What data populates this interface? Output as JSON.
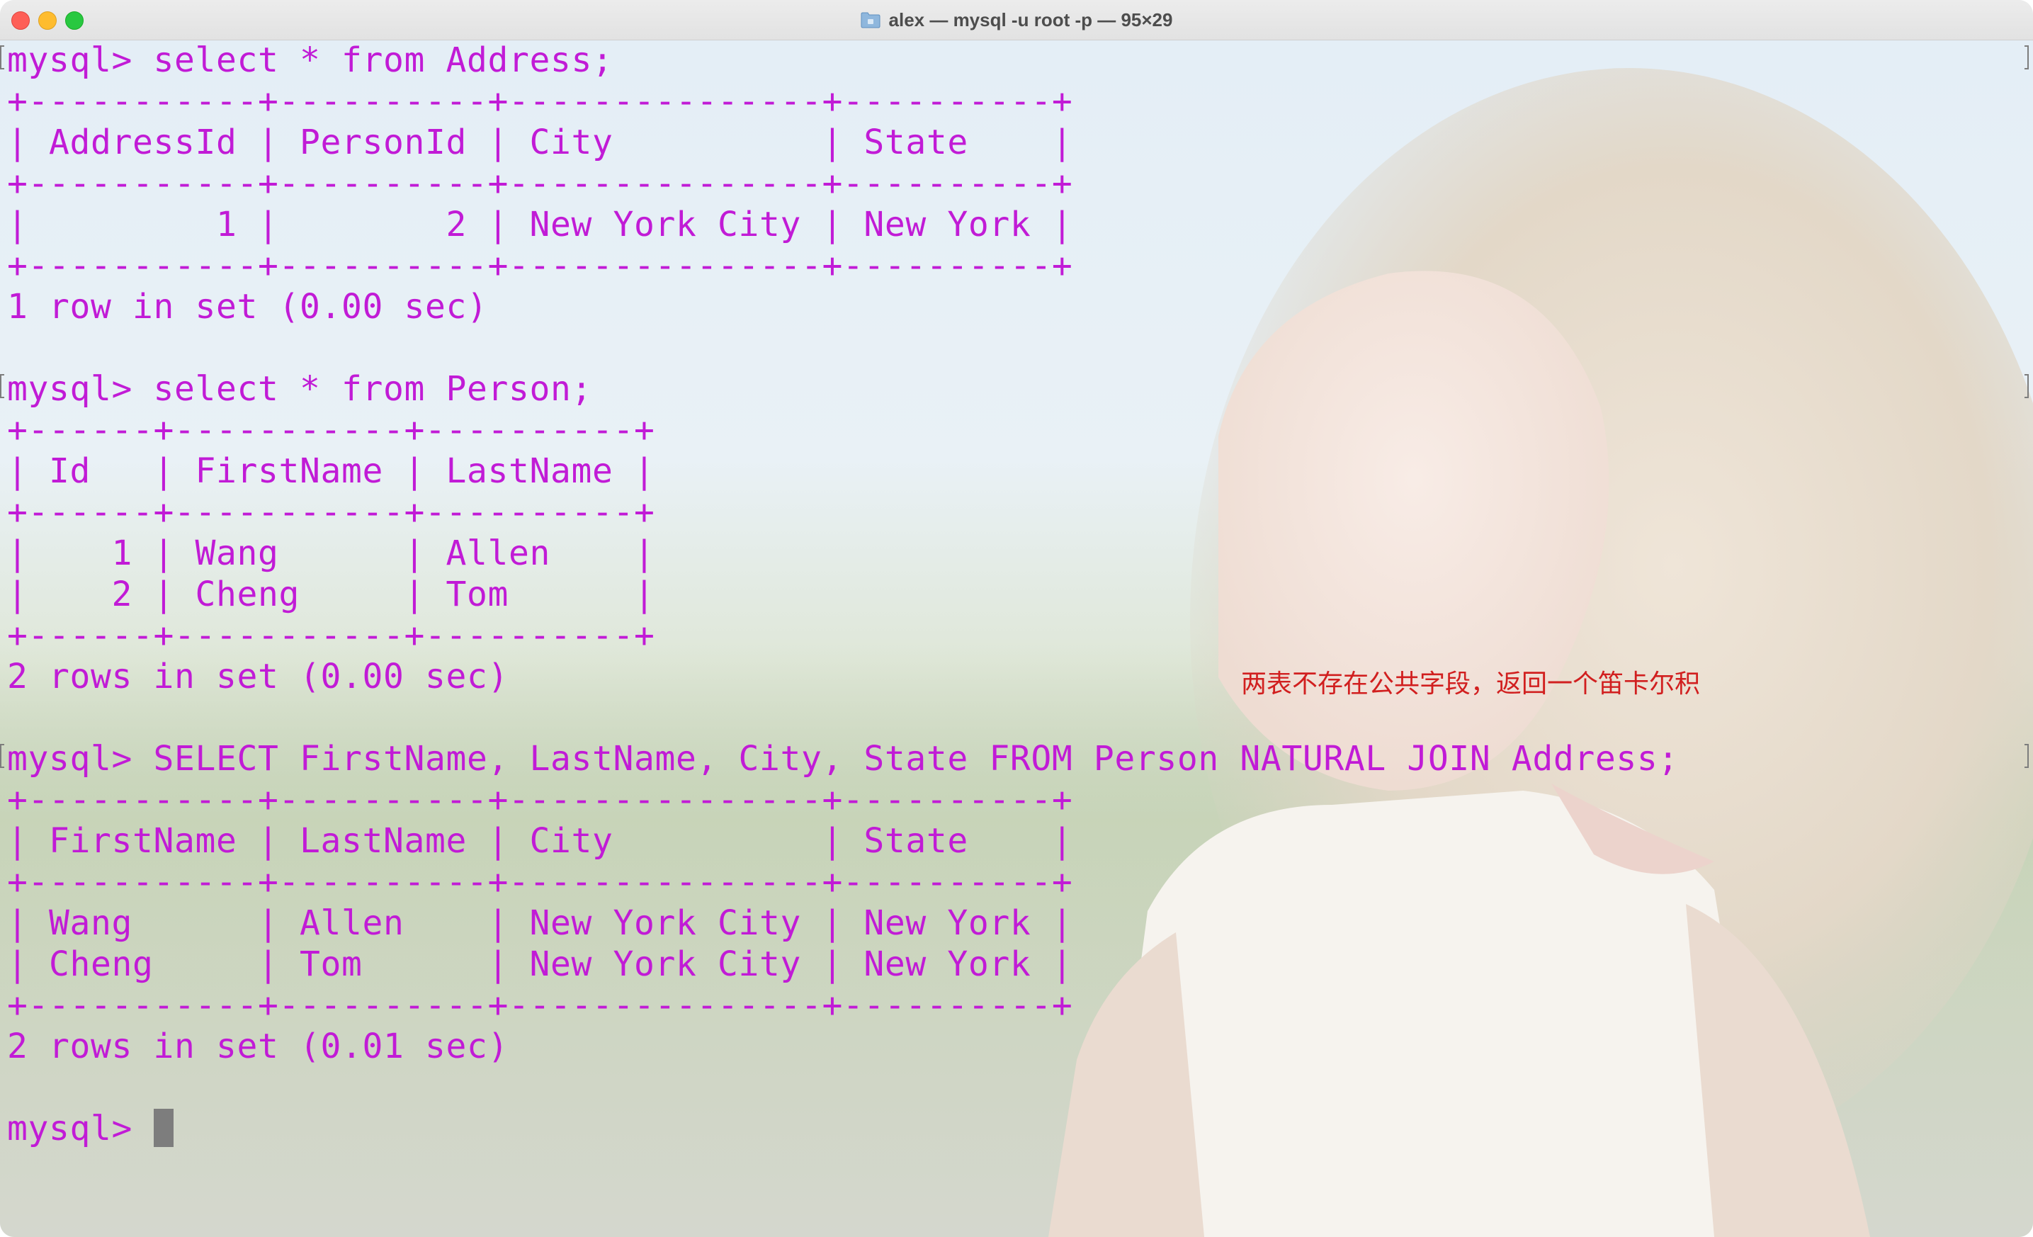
{
  "window": {
    "title": "alex — mysql -u root -p — 95×29"
  },
  "terminal": {
    "lines": [
      "mysql> select * from Address;",
      "+-----------+----------+---------------+----------+",
      "| AddressId | PersonId | City          | State    |",
      "+-----------+----------+---------------+----------+",
      "|         1 |        2 | New York City | New York |",
      "+-----------+----------+---------------+----------+",
      "1 row in set (0.00 sec)",
      "",
      "mysql> select * from Person;",
      "+------+-----------+----------+",
      "| Id   | FirstName | LastName |",
      "+------+-----------+----------+",
      "|    1 | Wang      | Allen    |",
      "|    2 | Cheng     | Tom      |",
      "+------+-----------+----------+",
      "2 rows in set (0.00 sec)",
      "",
      "mysql> SELECT FirstName, LastName, City, State FROM Person NATURAL JOIN Address;",
      "+-----------+----------+---------------+----------+",
      "| FirstName | LastName | City          | State    |",
      "+-----------+----------+---------------+----------+",
      "| Wang      | Allen    | New York City | New York |",
      "| Cheng     | Tom      | New York City | New York |",
      "+-----------+----------+---------------+----------+",
      "2 rows in set (0.01 sec)",
      "",
      "mysql> "
    ],
    "text_color": "#c11bd6"
  },
  "annotation": {
    "text": "两表不存在公共字段，返回一个笛卡尔积",
    "color": "#d11f1f"
  },
  "icons": {
    "title_icon": "folder-icon"
  }
}
